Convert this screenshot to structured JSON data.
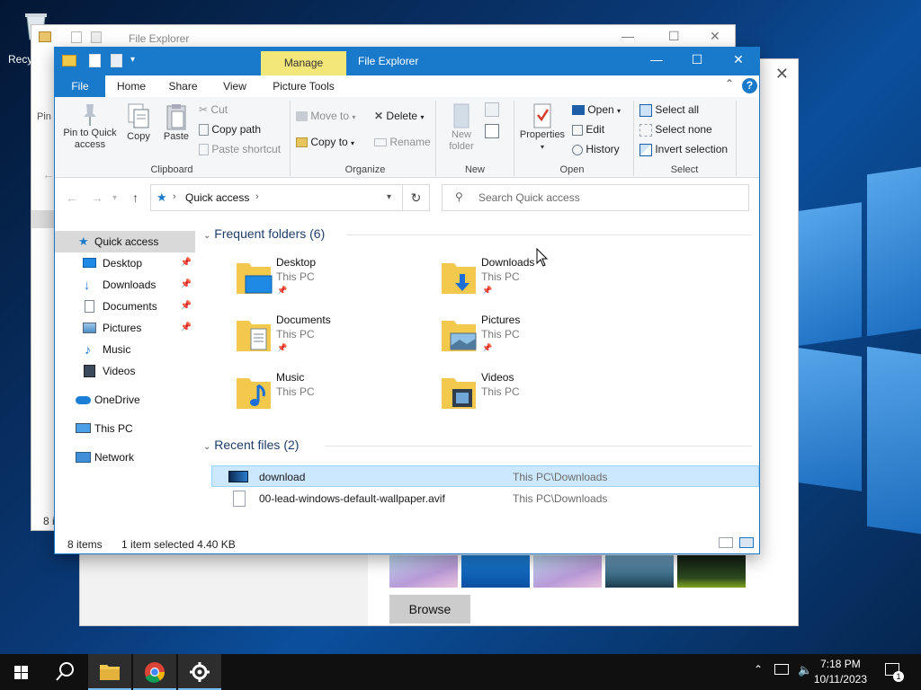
{
  "desktop": {
    "recycle_bin_label": "Recy"
  },
  "back_explorer": {
    "title": "File Explorer",
    "pin_fragment": "Pin",
    "items_fragment": "8 i"
  },
  "settings_window": {
    "browse_label": "Browse",
    "close_glyph": "✕"
  },
  "explorer": {
    "title": "File Explorer",
    "manage_tab": "Manage",
    "tabs": {
      "file": "File",
      "home": "Home",
      "share": "Share",
      "view": "View",
      "picture_tools": "Picture Tools"
    },
    "ribbon": {
      "clipboard": {
        "group": "Clipboard",
        "pin_line1": "Pin to Quick",
        "pin_line2": "access",
        "copy": "Copy",
        "paste": "Paste",
        "cut": "Cut",
        "copy_path": "Copy path",
        "paste_shortcut": "Paste shortcut"
      },
      "organize": {
        "group": "Organize",
        "move_to": "Move to",
        "copy_to": "Copy to",
        "delete": "Delete",
        "rename": "Rename"
      },
      "new": {
        "group": "New",
        "new_folder_line1": "New",
        "new_folder_line2": "folder"
      },
      "open": {
        "group": "Open",
        "properties": "Properties",
        "open": "Open",
        "edit": "Edit",
        "history": "History"
      },
      "select": {
        "group": "Select",
        "select_all": "Select all",
        "select_none": "Select none",
        "invert_selection": "Invert selection"
      }
    },
    "address": {
      "location": "Quick access",
      "search_placeholder": "Search Quick access"
    },
    "nav_pane": [
      {
        "label": "Quick access",
        "pinned": false
      },
      {
        "label": "Desktop",
        "pinned": true
      },
      {
        "label": "Downloads",
        "pinned": true
      },
      {
        "label": "Documents",
        "pinned": true
      },
      {
        "label": "Pictures",
        "pinned": true
      },
      {
        "label": "Music",
        "pinned": false
      },
      {
        "label": "Videos",
        "pinned": false
      },
      {
        "label": "OneDrive",
        "pinned": false
      },
      {
        "label": "This PC",
        "pinned": false
      },
      {
        "label": "Network",
        "pinned": false
      }
    ],
    "frequent_header": "Frequent folders (6)",
    "frequent_folders": [
      {
        "name": "Desktop",
        "location": "This PC"
      },
      {
        "name": "Downloads",
        "location": "This PC"
      },
      {
        "name": "Documents",
        "location": "This PC"
      },
      {
        "name": "Pictures",
        "location": "This PC"
      },
      {
        "name": "Music",
        "location": "This PC"
      },
      {
        "name": "Videos",
        "location": "This PC"
      }
    ],
    "recent_header": "Recent files (2)",
    "recent_files": [
      {
        "name": "download",
        "path": "This PC\\Downloads"
      },
      {
        "name": "00-lead-windows-default-wallpaper.avif",
        "path": "This PC\\Downloads"
      }
    ],
    "status": {
      "items": "8 items",
      "selection": "1 item selected  4.40 KB"
    }
  },
  "taskbar": {
    "time": "7:18 PM",
    "date": "10/11/2023",
    "notification_count": "1"
  },
  "colors": {
    "accent": "#1979ca",
    "manage_tab": "#f3e779",
    "selection": "#cce8ff"
  }
}
